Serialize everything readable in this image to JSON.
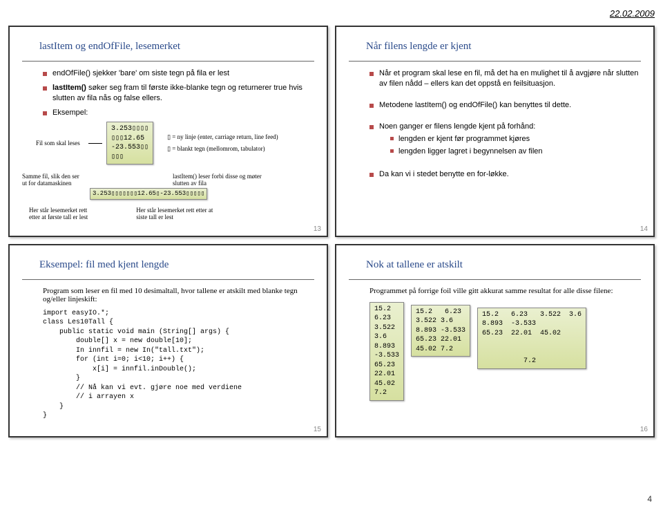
{
  "header": {
    "date": "22.02.2009",
    "page_number_footer": "4"
  },
  "slide13": {
    "title": "lastItem og endOfFile, lesemerket",
    "b1": "endOfFile() sjekker 'bare' om siste tegn på fila er lest",
    "b2_pre": "lastItem()",
    "b2_rest": " søker seg fram til første ikke-blanke tegn og returnerer true hvis slutten av fila nås og false ellers.",
    "b3": "Eksempel:",
    "label_file_read": "Fil som skal leses",
    "filebox_lines": "3.253▯▯▯▯\n▯▯▯12.65\n-23.553▯▯\n▯▯▯",
    "legend_newline": "▯ = ny linje (enter, carriage return, line feed)",
    "legend_blank": "▯ = blankt tegn (mellomrom, tabulator)",
    "label_same_file": "Samme fil, slik den ser\nut for datamaskinen",
    "note_lastItem": "lastItem() leser forbi disse og møter\nslutten av fila",
    "tape": "3.253▯▯▯▯▯▯▯12.65▯-23.553▯▯▯▯▯",
    "note_first": "Her står lesemerket rett\netter at første tall er lest",
    "note_last": "Her står lesemerket rett etter at\nsiste tall er lest",
    "pagenum": "13"
  },
  "slide14": {
    "title": "Når filens lengde er kjent",
    "b1": "Når et program skal lese en fil, må det ha en mulighet til å avgjøre når slutten av filen nådd – ellers kan det oppstå en feilsituasjon.",
    "b2": "Metodene lastItem() og endOfFile() kan benyttes til dette.",
    "b3": "Noen ganger er filens lengde kjent på forhånd:",
    "b3s1": "lengden er kjent før programmet kjøres",
    "b3s2": "lengden ligger lagret i begynnelsen av filen",
    "b4": "Da kan vi i stedet benytte en for-løkke.",
    "pagenum": "14"
  },
  "slide15": {
    "title": "Eksempel: fil med kjent lengde",
    "intro": "Program som leser en fil med 10 desimaltall, hvor tallene er atskilt med blanke tegn og/eller linjeskift:",
    "code": "import easyIO.*;\nclass Les10Tall {\n    public static void main (String[] args) {\n        double[] x = new double[10];\n        In innfil = new In(\"tall.txt\");\n        for (int i=0; i<10; i++) {\n            x[i] = innfil.inDouble();\n        }\n        // Nå kan vi evt. gjøre noe med verdiene\n        // i arrayen x\n    }\n}",
    "pagenum": "15"
  },
  "slide16": {
    "title": "Nok at tallene er atskilt",
    "intro": "Programmet på forrige foil ville gitt akkurat samme resultat for alle disse filene:",
    "box1": "15.2\n6.23\n3.522\n3.6\n8.893\n-3.533\n65.23\n22.01\n45.02\n7.2",
    "box2": "15.2   6.23\n3.522 3.6\n8.893 -3.533\n65.23 22.01\n45.02 7.2",
    "box3": "15.2   6.23   3.522  3.6\n8.893  -3.533\n65.23  22.01  45.02\n\n\n          7.2",
    "pagenum": "16"
  }
}
